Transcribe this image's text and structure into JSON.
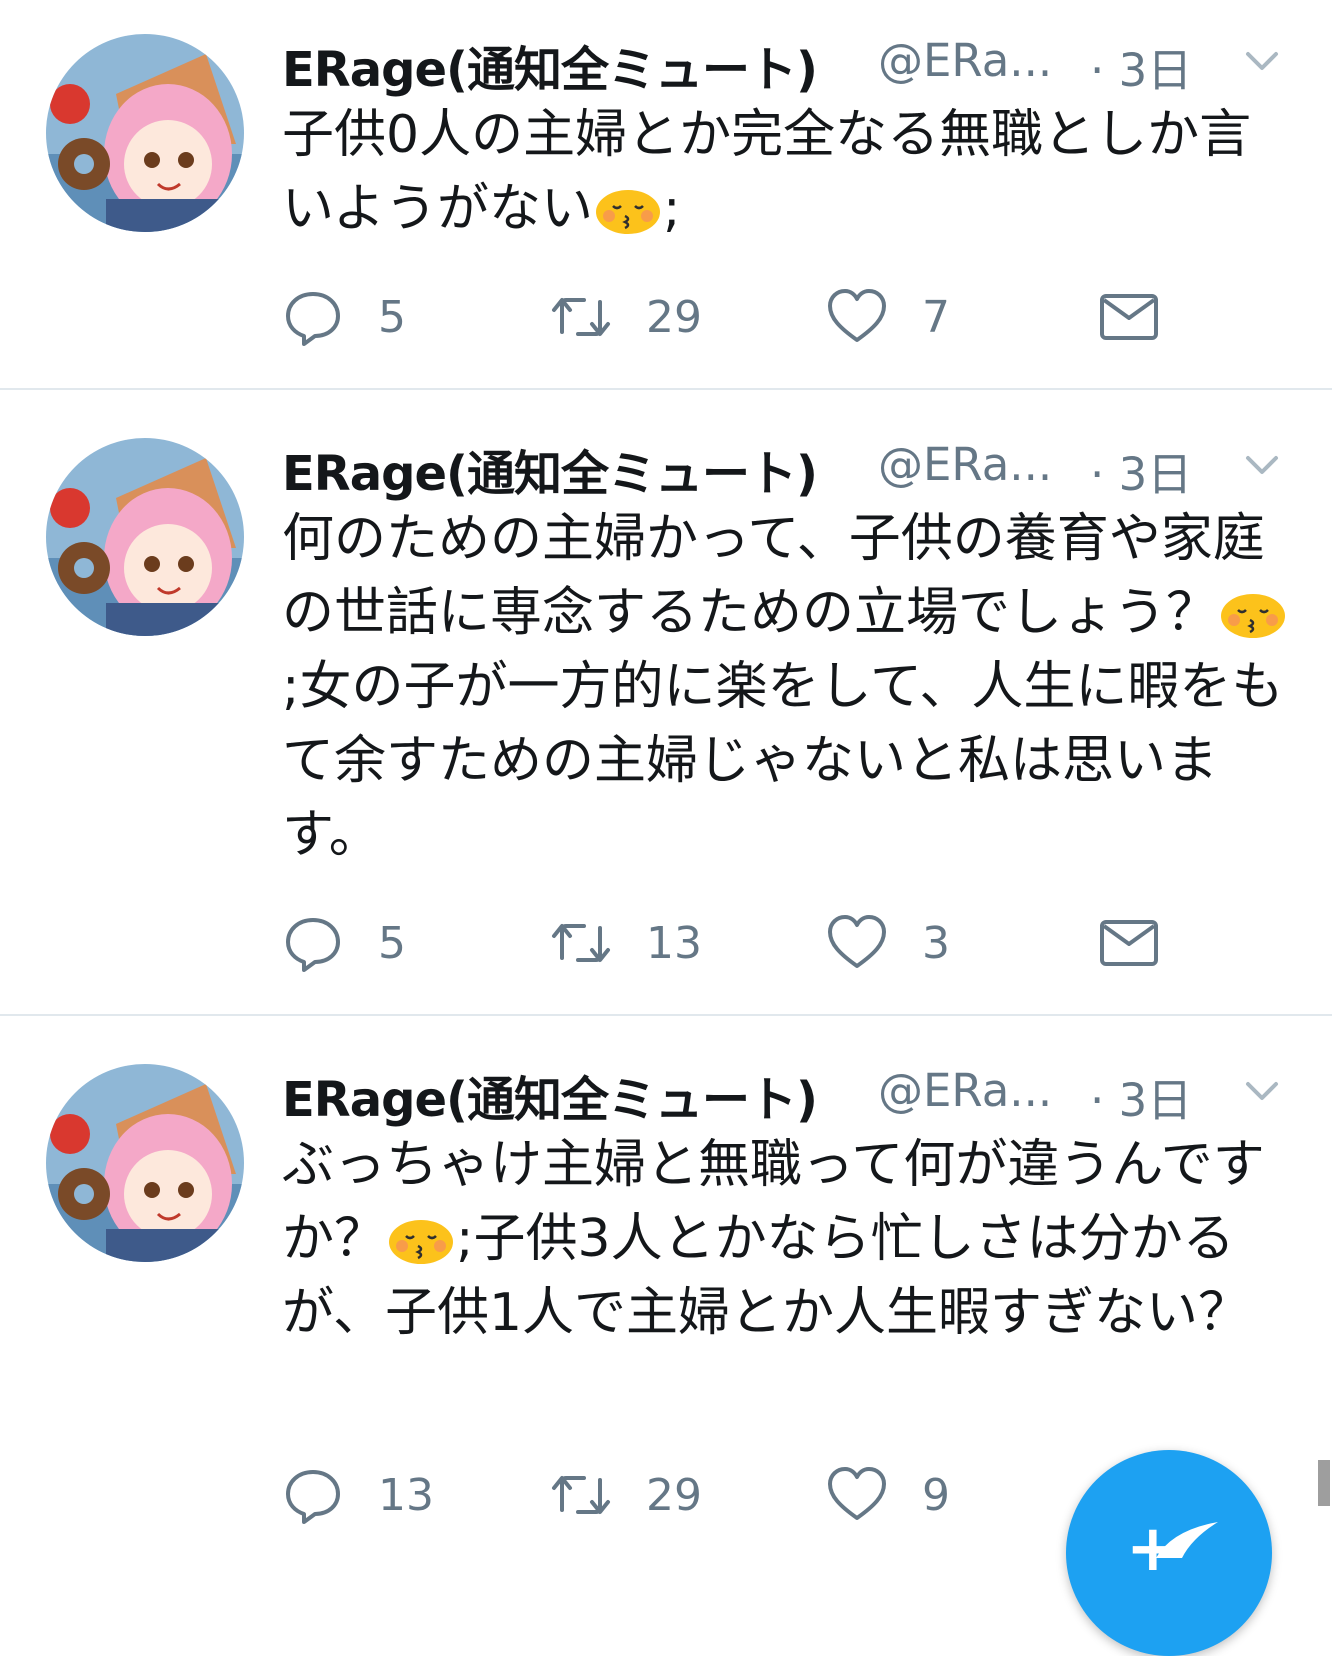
{
  "colors": {
    "accent": "#1da1f2",
    "secondary_text": "#657786",
    "divider": "#e1e8ed"
  },
  "tweets": [
    {
      "display_name": "ERage(通知全ミュート)",
      "handle": "@ERa...",
      "time": "· 3日",
      "text_parts": [
        "子供0人の主婦とか完全なる無職としか言いようがない",
        ";"
      ],
      "replies": "5",
      "retweets": "29",
      "likes": "7"
    },
    {
      "display_name": "ERage(通知全ミュート)",
      "handle": "@ERa...",
      "time": "· 3日",
      "text_parts": [
        "何のための主婦かって、子供の養育や家庭の世話に専念するための立場でしょう？",
        ";女の子が一方的に楽をして、人生に暇をもて余すための主婦じゃないと私は思います。"
      ],
      "replies": "5",
      "retweets": "13",
      "likes": "3"
    },
    {
      "display_name": "ERage(通知全ミュート)",
      "handle": "@ERa...",
      "time": "· 3日",
      "text_parts": [
        "ぶっちゃけ主婦と無職って何が違うんですか？",
        ";子供3人とかなら忙しさは分かるが、子供1人で主婦とか人生暇すぎない？"
      ],
      "replies": "13",
      "retweets": "29",
      "likes": "9"
    }
  ],
  "icons": {
    "reply": "reply-icon",
    "retweet": "retweet-icon",
    "like": "heart-icon",
    "dm": "envelope-icon",
    "caret": "chevron-down-icon",
    "emoji": "kissing-face-emoji",
    "compose": "compose-tweet-icon"
  }
}
